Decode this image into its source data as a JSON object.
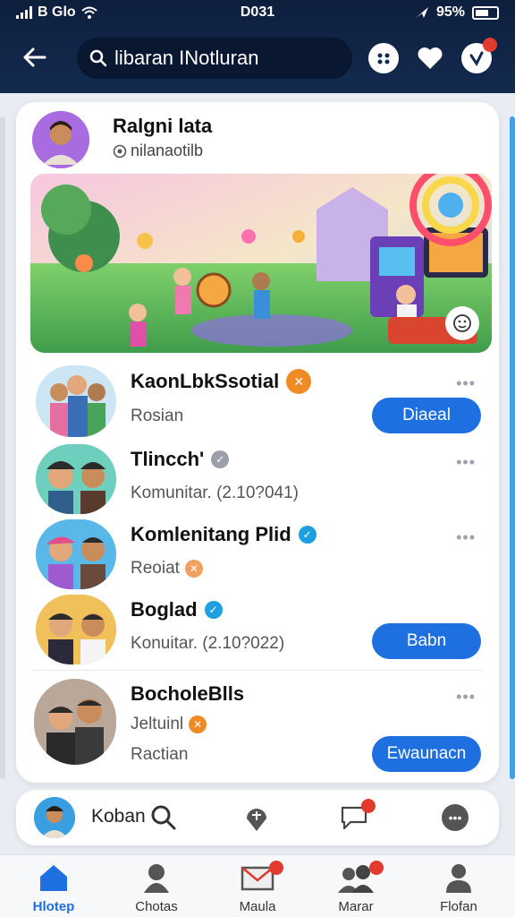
{
  "status_bar": {
    "carrier": "B Glo",
    "time": "D031",
    "battery": "95%"
  },
  "header": {
    "search": {
      "value": "libaran INotluran",
      "placeholder": ""
    }
  },
  "profile": {
    "name": "Ralgni lata",
    "handle": "nilanaotilb"
  },
  "list": [
    {
      "name": "KaonLbkSsotial",
      "sub": "Rosian",
      "button": "Diaeal",
      "badge_color": "#f08a24"
    },
    {
      "name": "Tlincch'",
      "sub": "Komunitar. (2.10?041)",
      "button": "",
      "badge_color": "#9aa0a6"
    },
    {
      "name": "Komlenitang Plid",
      "sub": "Reoiat",
      "button": "",
      "badge_color": "#1ea0e0"
    },
    {
      "name": "Boglad",
      "sub": "Konuitar. (2.10?022)",
      "button": "Babn",
      "badge_color": "#1ea0e0"
    },
    {
      "name": "BocholeBlls",
      "sub": "Jeltuinl",
      "sub2": "Ractian",
      "button": "Ewaunacn",
      "badge_color": "#f08a24"
    }
  ],
  "action_bar": {
    "label": "Koban"
  },
  "tabs": [
    {
      "label": "Hlotep",
      "icon": "home-icon"
    },
    {
      "label": "Chotas",
      "icon": "person-icon"
    },
    {
      "label": "Maula",
      "icon": "mail-icon"
    },
    {
      "label": "Marar",
      "icon": "group-icon"
    },
    {
      "label": "Flofan",
      "icon": "profile-icon"
    }
  ],
  "colors": {
    "header_bg": "#132a4f",
    "accent": "#1e6fe0",
    "badge": "#e23b2e"
  }
}
